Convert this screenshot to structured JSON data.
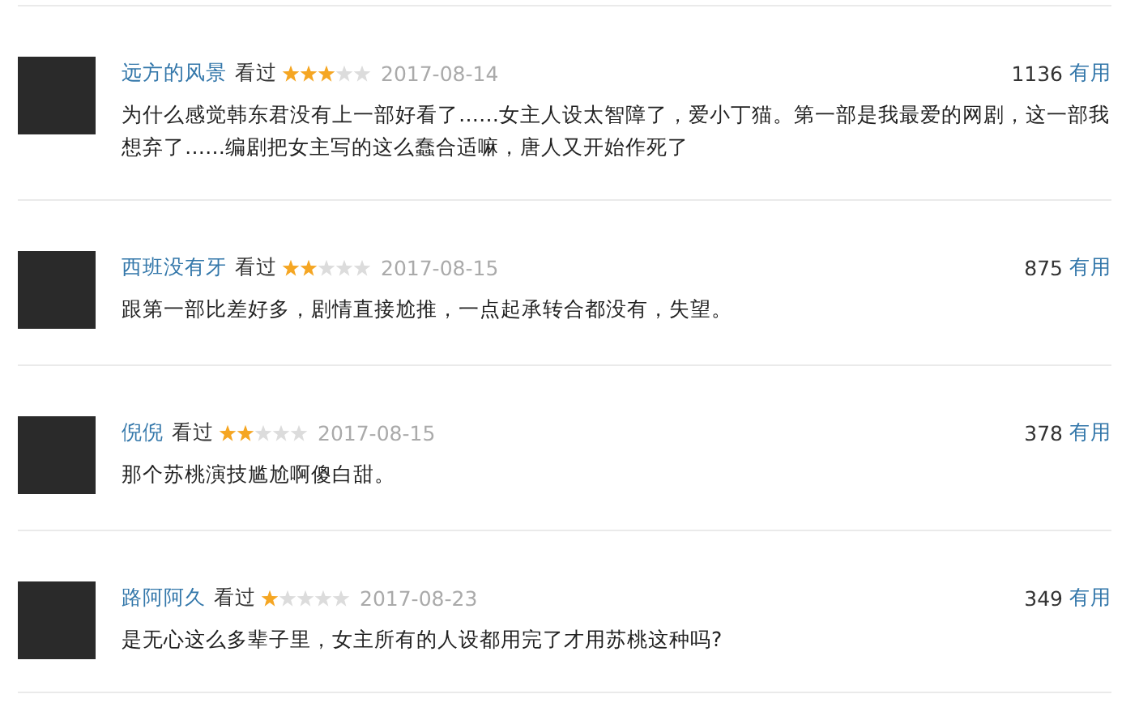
{
  "reviews": [
    {
      "user": "远方的风景",
      "status": "看过",
      "stars": 3,
      "date": "2017-08-14",
      "votes": "1136",
      "useful": "有用",
      "comment": "为什么感觉韩东君没有上一部好看了……女主人设太智障了，爱小丁猫。第一部是我最爱的网剧，这一部我想弃了……编剧把女主写的这么蠢合适嘛，唐人又开始作死了"
    },
    {
      "user": "西班没有牙",
      "status": "看过",
      "stars": 2,
      "date": "2017-08-15",
      "votes": "875",
      "useful": "有用",
      "comment": "跟第一部比差好多，剧情直接尬推，一点起承转合都没有，失望。"
    },
    {
      "user": "倪倪",
      "status": "看过",
      "stars": 2,
      "date": "2017-08-15",
      "votes": "378",
      "useful": "有用",
      "comment": "那个苏桃演技尴尬啊傻白甜。"
    },
    {
      "user": "路阿阿久",
      "status": "看过",
      "stars": 1,
      "date": "2017-08-23",
      "votes": "349",
      "useful": "有用",
      "comment": "是无心这么多辈子里，女主所有的人设都用完了才用苏桃这种吗?"
    }
  ]
}
